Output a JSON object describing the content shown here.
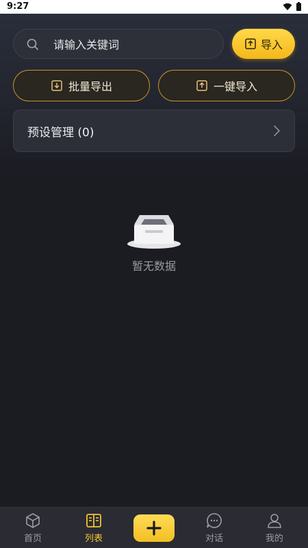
{
  "status_bar": {
    "time": "9:27"
  },
  "search": {
    "placeholder": "请输入关键词"
  },
  "import_button": {
    "label": "导入"
  },
  "actions": {
    "bulk_export": "批量导出",
    "one_click_import": "一键导入"
  },
  "preset": {
    "label": "预设管理 (0)"
  },
  "empty_state": {
    "text": "暂无数据"
  },
  "bottom_nav": {
    "items": [
      {
        "label": "首页",
        "icon": "home-icon",
        "active": false
      },
      {
        "label": "列表",
        "icon": "list-icon",
        "active": true
      },
      {
        "label": "对话",
        "icon": "chat-icon",
        "active": false
      },
      {
        "label": "我的",
        "icon": "profile-icon",
        "active": false
      }
    ],
    "add_icon": "plus-icon"
  },
  "colors": {
    "accent": "#f4c531",
    "background": "#1b1b22",
    "outline": "#c9912a",
    "muted_text": "#9a9aa3"
  }
}
